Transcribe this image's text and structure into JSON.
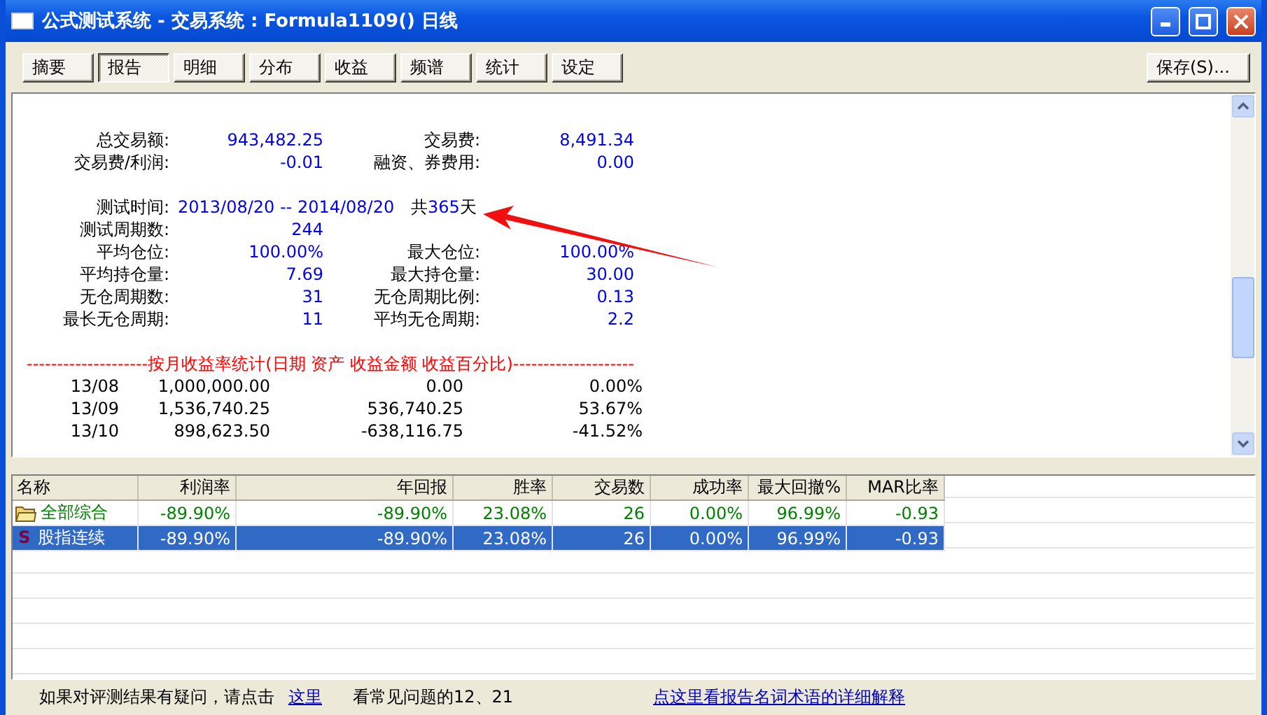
{
  "window": {
    "title": "公式测试系统 - 交易系统 : Formula1109() 日线"
  },
  "tabs": [
    {
      "label": "摘要",
      "selected": false
    },
    {
      "label": "报告",
      "selected": true
    },
    {
      "label": "明细",
      "selected": false
    },
    {
      "label": "分布",
      "selected": false
    },
    {
      "label": "收益",
      "selected": false
    },
    {
      "label": "频谱",
      "selected": false
    },
    {
      "label": "统计",
      "selected": false
    },
    {
      "label": "设定",
      "selected": false
    }
  ],
  "save_button": "保存(S)...",
  "report": {
    "groups": [
      [
        {
          "kind": "pair",
          "label": "总交易额:",
          "value": "943,482.25",
          "label_2": "交易费:",
          "value_2": "8,491.34"
        },
        {
          "kind": "pair",
          "label": "交易费/利润:",
          "value": "-0.01",
          "label_2": "融资、券费用:",
          "value_2": "0.00"
        }
      ],
      [
        {
          "kind": "range",
          "label": "测试时间:",
          "value": "2013/08/20 -- 2014/08/20",
          "days_prefix": "共",
          "days": "365",
          "days_suffix": "天"
        },
        {
          "kind": "single",
          "label": "测试周期数:",
          "value": "244"
        },
        {
          "kind": "pair",
          "label": "平均仓位:",
          "value": "100.00%",
          "label_2": "最大仓位:",
          "value_2": "100.00%"
        },
        {
          "kind": "pair",
          "label": "平均持仓量:",
          "value": "7.69",
          "label_2": "最大持仓量:",
          "value_2": "30.00"
        },
        {
          "kind": "pair",
          "label": "无仓周期数:",
          "value": "31",
          "label_2": "无仓周期比例:",
          "value_2": "0.13"
        },
        {
          "kind": "pair",
          "label": "最长无仓周期:",
          "value": "11",
          "label_2": "平均无仓周期:",
          "value_2": "2.2"
        }
      ]
    ],
    "monthly_heading": "--------------------按月收益率统计(日期 资产 收益金额 收益百分比)--------------------",
    "monthly_rows": [
      [
        "13/08",
        "1,000,000.00",
        "0.00",
        "0.00%"
      ],
      [
        "13/09",
        "1,536,740.25",
        "536,740.25",
        "53.67%"
      ],
      [
        "13/10",
        "898,623.50",
        "-638,116.75",
        "-41.52%"
      ]
    ]
  },
  "results": {
    "columns": [
      "名称",
      "利润率",
      "年回报",
      "胜率",
      "交易数",
      "成功率",
      "最大回撤%",
      "MAR比率"
    ],
    "rows": [
      {
        "kind": "folder",
        "selected": false,
        "cells": [
          "全部综合",
          "-89.90%",
          "-89.90%",
          "23.08%",
          "26",
          "0.00%",
          "96.99%",
          "-0.93"
        ]
      },
      {
        "kind": "strategy",
        "selected": true,
        "icon_letter": "S",
        "cells": [
          "股指连续",
          "-89.90%",
          "-89.90%",
          "23.08%",
          "26",
          "0.00%",
          "96.99%",
          "-0.93"
        ]
      }
    ]
  },
  "footer": {
    "prompt": "如果对评测结果有疑问，请点击",
    "link": "这里",
    "note": "看常见问题的12、21",
    "glossary_link": "点这里看报告名词术语的详细解释"
  }
}
